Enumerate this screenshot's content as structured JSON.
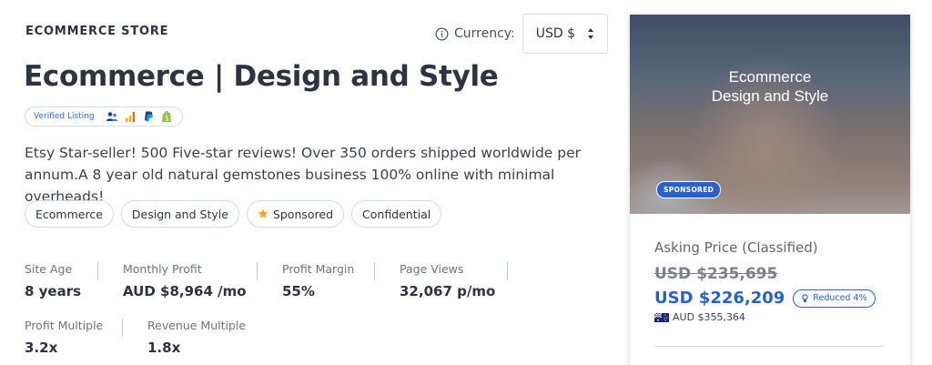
{
  "header": {
    "eyebrow": "ECOMMERCE STORE",
    "currency_label": "Currency:",
    "currency_value": "USD $"
  },
  "listing": {
    "title": "Ecommerce | Design and Style",
    "verified_label": "Verified Listing",
    "verified_icons": [
      "users-icon",
      "analytics-icon",
      "paypal-icon",
      "shopify-icon"
    ],
    "description": "Etsy Star-seller! 500 Five-star reviews! Over 350 orders shipped worldwide per annum.A 8 year old natural gemstones business 100% online with minimal overheads!",
    "tags": [
      "Ecommerce",
      "Design and Style",
      "Sponsored",
      "Confidential"
    ]
  },
  "metrics": [
    {
      "label": "Site Age",
      "value": "8 years"
    },
    {
      "label": "Monthly Profit",
      "value": "AUD $8,964 /mo"
    },
    {
      "label": "Profit Margin",
      "value": "55%"
    },
    {
      "label": "Page Views",
      "value": "32,067 p/mo"
    },
    {
      "label": "Profit Multiple",
      "value": "3.2x"
    },
    {
      "label": "Revenue Multiple",
      "value": "1.8x"
    }
  ],
  "card": {
    "hero_title_line1": "Ecommerce",
    "hero_title_line2": "Design and Style",
    "sponsored_badge": "SPONSORED",
    "asking_label": "Asking Price (Classified)",
    "old_price": "USD $235,695",
    "new_price": "USD $226,209",
    "reduced_label": "Reduced 4%",
    "aud_price": "AUD $355,364"
  },
  "colors": {
    "accent": "#2862c9",
    "text": "#2d3340",
    "star": "#f5a623"
  }
}
